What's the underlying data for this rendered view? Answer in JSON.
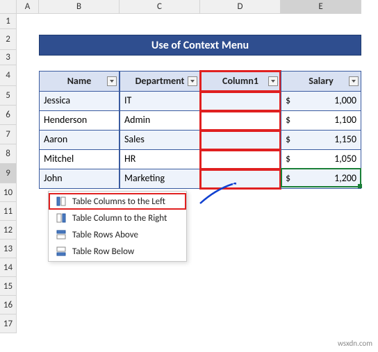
{
  "columns": [
    "A",
    "B",
    "C",
    "D",
    "E"
  ],
  "rows": [
    "1",
    "2",
    "3",
    "4",
    "5",
    "6",
    "7",
    "8",
    "9",
    "10",
    "11",
    "12",
    "13",
    "14",
    "15",
    "16",
    "17"
  ],
  "title": "Use of Context Menu",
  "headers": {
    "name": "Name",
    "dept": "Department",
    "col1": "Column1",
    "sal": "Salary"
  },
  "data": [
    {
      "name": "Jessica",
      "dept": "IT",
      "sal": "1,000"
    },
    {
      "name": "Henderson",
      "dept": "Admin",
      "sal": "1,100"
    },
    {
      "name": "Aaron",
      "dept": "Sales",
      "sal": "1,150"
    },
    {
      "name": "Mitchel",
      "dept": "HR",
      "sal": "1,050"
    },
    {
      "name": "John",
      "dept": "Marketing",
      "sal": "1,200"
    }
  ],
  "currency": "$",
  "menu": {
    "left": "Table Columns to the Left",
    "right": "Table Column to the Right",
    "above": "Table Rows Above",
    "below": "Table Row Below"
  },
  "watermark": "wsxdn.com"
}
